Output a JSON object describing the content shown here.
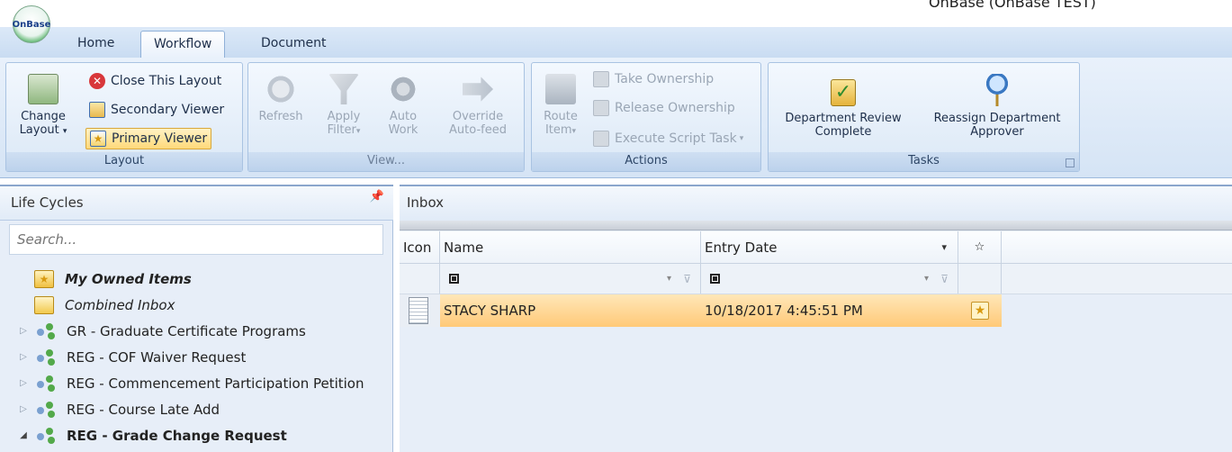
{
  "app": {
    "title": "OnBase (OnBase TEST)",
    "logo_text": "OnBase"
  },
  "tabs": [
    {
      "label": "Home"
    },
    {
      "label": "Workflow"
    },
    {
      "label": "Document"
    }
  ],
  "ribbon": {
    "layout": {
      "label": "Layout",
      "change_layout_line1": "Change",
      "change_layout_line2": "Layout",
      "close_layout": "Close This Layout",
      "secondary_viewer": "Secondary Viewer",
      "primary_viewer": "Primary Viewer"
    },
    "view": {
      "label": "View...",
      "refresh": "Refresh",
      "apply_filter_line1": "Apply",
      "apply_filter_line2": "Filter",
      "auto_work_line1": "Auto",
      "auto_work_line2": "Work",
      "override_line1": "Override",
      "override_line2": "Auto-feed"
    },
    "actions": {
      "label": "Actions",
      "route_line1": "Route",
      "route_line2": "Item",
      "take_ownership": "Take Ownership",
      "release_ownership": "Release Ownership",
      "execute_script": "Execute Script Task"
    },
    "tasks": {
      "label": "Tasks",
      "dept_review_line1": "Department Review",
      "dept_review_line2": "Complete",
      "reassign_line1": "Reassign Department",
      "reassign_line2": "Approver"
    }
  },
  "life_cycles": {
    "title": "Life Cycles",
    "pin_icon": "pin-icon",
    "search_placeholder": "Search...",
    "my_owned_items": "My Owned Items",
    "combined_inbox": "Combined Inbox",
    "items": [
      {
        "label": "GR - Graduate Certificate Programs"
      },
      {
        "label": "REG - COF Waiver Request"
      },
      {
        "label": "REG - Commencement Participation Petition"
      },
      {
        "label": "REG - Course Late Add"
      },
      {
        "label": "REG - Grade Change Request"
      }
    ]
  },
  "inbox": {
    "title": "Inbox",
    "columns": {
      "icon": "Icon",
      "name": "Name",
      "entry_date": "Entry Date",
      "star": "☆"
    },
    "rows": [
      {
        "name": "STACY SHARP",
        "entry_date": "10/18/2017 4:45:51 PM"
      }
    ]
  },
  "colors": {
    "highlight": "#f2ff2a",
    "ribbon_bg": "#dbe8f6",
    "selected_row": "#ffc978"
  }
}
